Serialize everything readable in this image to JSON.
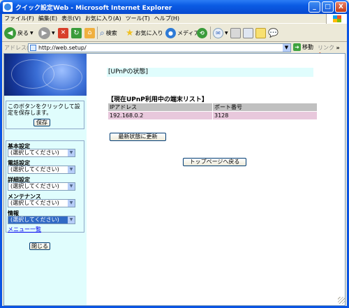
{
  "window": {
    "title": "クイック設定Web - Microsoft Internet Explorer",
    "minimize": "_",
    "maximize": "□",
    "close": "X"
  },
  "menubar": {
    "items": [
      "ファイル(F)",
      "編集(E)",
      "表示(V)",
      "お気に入り(A)",
      "ツール(T)",
      "ヘルプ(H)"
    ]
  },
  "toolbar": {
    "back_label": "戻る",
    "search_label": "検索",
    "favorites_label": "お気に入り",
    "media_label": "メディア"
  },
  "addressbar": {
    "label": "アドレス(D)",
    "url": "http://web.setup/",
    "go_label": "移動",
    "links_label": "リンク"
  },
  "sidebar": {
    "save_text": "このボタンをクリックして設定を保存します。",
    "save_button": "保存",
    "menus": [
      {
        "label": "基本設定",
        "selected": "(選択してください)"
      },
      {
        "label": "電話設定",
        "selected": "(選択してください)"
      },
      {
        "label": "詳細設定",
        "selected": "(選択してください)"
      },
      {
        "label": "メンテナンス",
        "selected": "(選択してください)"
      },
      {
        "label": "情報",
        "selected": "(選択してください)"
      }
    ],
    "menu_list_link": "メニュー一覧",
    "close_button": "閉じる"
  },
  "main": {
    "page_heading": "[UPnPの状態]",
    "section_title": "【現在UPnP利用中の端末リスト】",
    "table": {
      "headers": [
        "IPアドレス",
        "ポート番号"
      ],
      "rows": [
        [
          "192.168.0.2",
          "3128"
        ]
      ]
    },
    "refresh_button": "最新状態に更新",
    "top_page_button": "トップページへ戻る"
  },
  "colors": {
    "titlebar": "#0a5be4",
    "sidebar_bg": "#e0fdfd",
    "table_header_bg": "#c0c0c0",
    "table_row_bg": "#e8c8dc",
    "select_highlight": "#316ac5"
  }
}
